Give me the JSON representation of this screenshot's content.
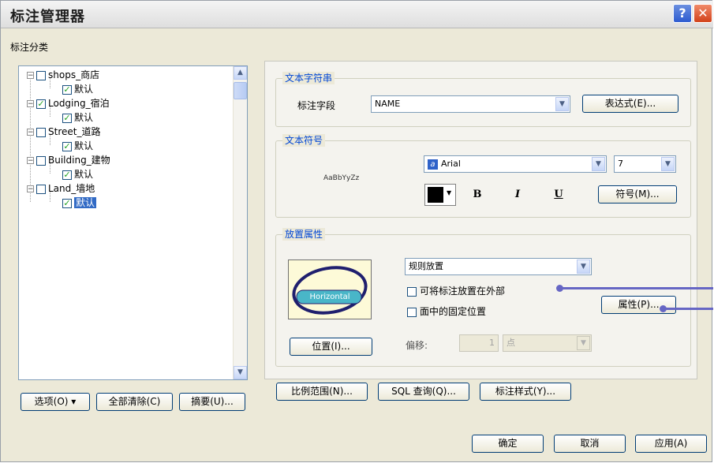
{
  "window": {
    "title": "标注管理器",
    "help_glyph": "?",
    "close_glyph": "✕"
  },
  "section_label": "标注分类",
  "tree": {
    "items": [
      {
        "layer": "shops_商店",
        "layer_checked": false,
        "class": "默认",
        "class_checked": true
      },
      {
        "layer": "Lodging_宿泊",
        "layer_checked": true,
        "class": "默认",
        "class_checked": true
      },
      {
        "layer": "Street_道路",
        "layer_checked": false,
        "class": "默认",
        "class_checked": true
      },
      {
        "layer": "Building_建物",
        "layer_checked": false,
        "class": "默认",
        "class_checked": true
      },
      {
        "layer": "Land_墙地",
        "layer_checked": false,
        "class": "默认",
        "class_checked": true
      }
    ],
    "expander_glyph": "−",
    "check_glyph": "✓",
    "selected_index": 4
  },
  "left_buttons": {
    "options": "选项(O) ▾",
    "clear_all": "全部清除(C)",
    "summary": "摘要(U)..."
  },
  "text_string": {
    "title": "文本字符串",
    "field_label": "标注字段",
    "field_value": "NAME",
    "expression_button": "表达式(E)..."
  },
  "text_symbol": {
    "title": "文本符号",
    "preview_text": "AaBbYyZz",
    "font_icon_glyph": "a",
    "font": "Arial",
    "size": "7",
    "color": "#000000",
    "bold": "B",
    "italic": "I",
    "underline": "U",
    "symbol_button": "符号(M)..."
  },
  "placement": {
    "title": "放置属性",
    "preview_label": "Horizontal",
    "method": "规则放置",
    "option1": "可将标注放置在外部",
    "option2": "面中的固定位置",
    "position_button": "位置(I)...",
    "properties_button": "属性(P)...",
    "offset_label": "偏移:",
    "offset_value": "1",
    "offset_unit": "点"
  },
  "bottom_buttons": {
    "scale_range": "比例范围(N)...",
    "sql_query": "SQL 查询(Q)...",
    "label_styles": "标注样式(Y)..."
  },
  "dialog_buttons": {
    "ok": "确定",
    "cancel": "取消",
    "apply": "应用(A)"
  },
  "colors": {
    "group_title": "#0046d5",
    "callout": "#6666c4",
    "preview_bg": "#fdfad8",
    "selection": "#316ac5"
  }
}
